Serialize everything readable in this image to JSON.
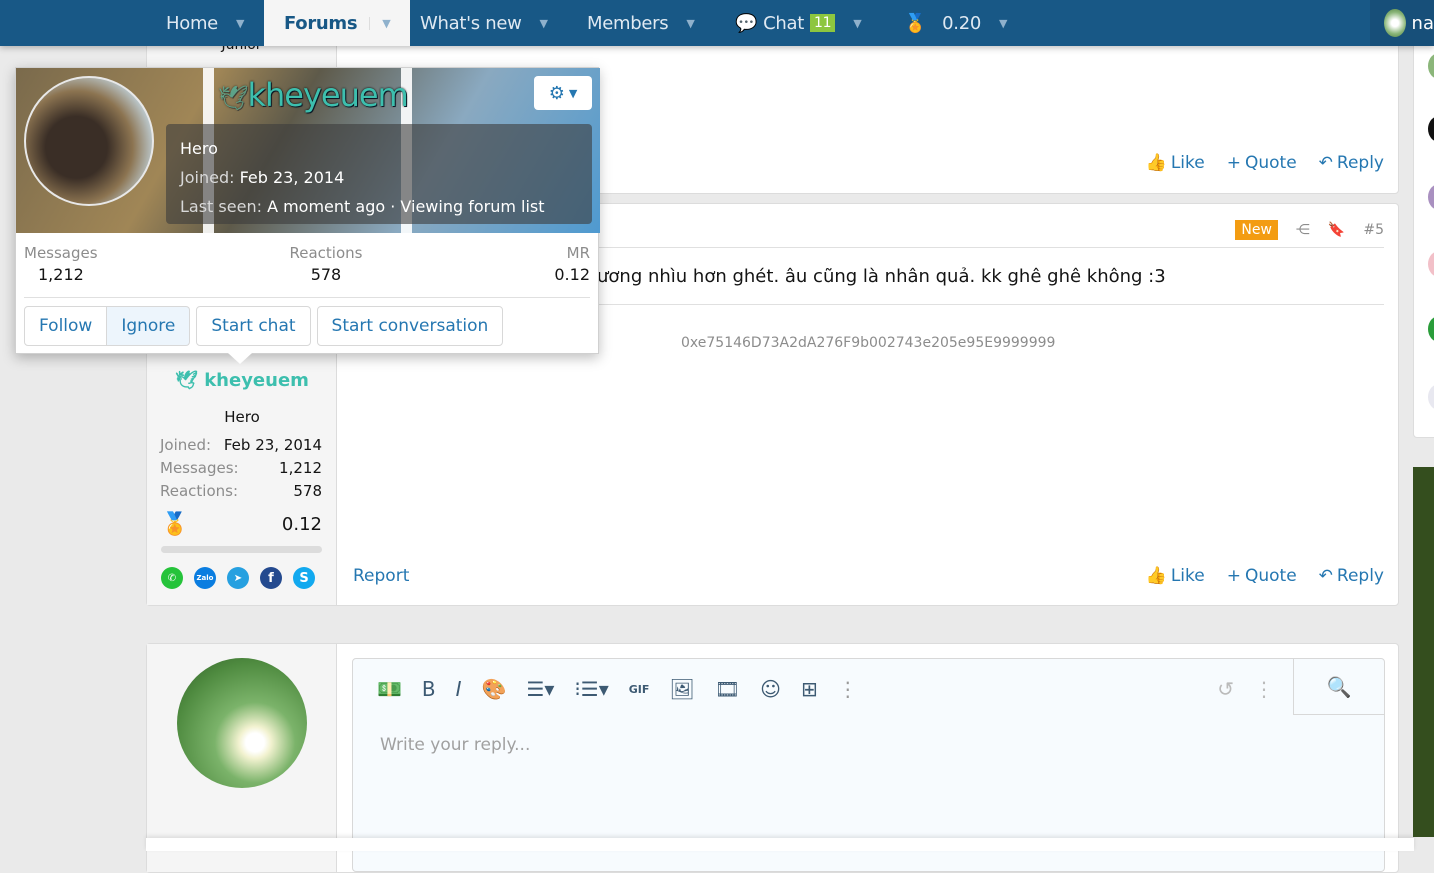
{
  "nav": {
    "home": "Home",
    "forums": "Forums",
    "whats_new": "What's new",
    "members": "Members",
    "chat": "Chat",
    "chat_count": "11",
    "balance": "0.20",
    "account": "na"
  },
  "popup": {
    "username": "kheyeuem",
    "title": "Hero",
    "joined_label": "Joined:",
    "joined": "Feb 23, 2014",
    "last_seen_label": "Last seen:",
    "last_seen": "A moment ago · Viewing forum list",
    "messages_label": "Messages",
    "messages": "1,212",
    "reactions_label": "Reactions",
    "reactions": "578",
    "mr_label": "MR",
    "mr": "0.12",
    "follow": "Follow",
    "ignore": "Ignore",
    "start_chat": "Start chat",
    "start_conversation": "Start conversation"
  },
  "prev_post": {
    "user_title": "Junior",
    "like": "Like",
    "quote": "Quote",
    "reply": "Reply"
  },
  "post": {
    "new_badge": "New",
    "number": "#5",
    "text": "ương nhìu hơn ghét. âu cũng là nhân quả. kk ghê ghê không :3",
    "signature": "0xe75146D73A2dA276F9b002743e205e95E9999999",
    "report": "Report",
    "like": "Like",
    "quote": "Quote",
    "reply": "Reply",
    "user": {
      "name": "kheyeuem",
      "title": "Hero",
      "joined_label": "Joined:",
      "joined": "Feb 23, 2014",
      "messages_label": "Messages:",
      "messages": "1,212",
      "reactions_label": "Reactions:",
      "reactions": "578",
      "mr": "0.12",
      "zalo": "Zalo"
    }
  },
  "reply": {
    "placeholder": "Write your reply..."
  }
}
